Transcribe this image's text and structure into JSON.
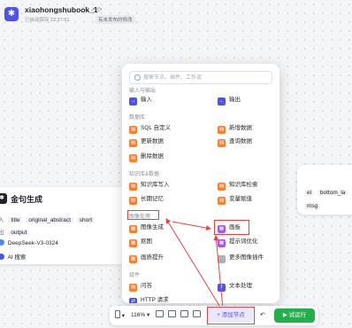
{
  "header": {
    "app_logo": "✱",
    "title": "xiaohongshubook_1",
    "title_icons": "ⓘ ↗ ⟳",
    "save_status": "已自动保存 22:37:51",
    "unpublished_badge": "有未发布的修改"
  },
  "left_node": {
    "icon": "✱",
    "title": "金句生成",
    "input_label": "入",
    "input_chips": [
      "title",
      "original_abstract",
      "short"
    ],
    "output_label": "出",
    "output_chip": "output",
    "model": "DeepSeek-V3-0324",
    "plugin": "AI 搜索"
  },
  "right_node": {
    "chip_a": "el",
    "chip_b": "bottom_la",
    "chip_c": "msg"
  },
  "menu": {
    "search_placeholder": "搜索节点、插件、工作流",
    "partial_section": "输入与输出",
    "io_items": [
      "输入",
      "输出"
    ],
    "db_section": "数据库",
    "db_items": [
      "SQL 自定义",
      "新增数据",
      "更新数据",
      "查询数据",
      "删除数据"
    ],
    "kb_section": "知识库&数据",
    "kb_items": [
      "知识库写入",
      "知识库检索",
      "长期记忆",
      "变量赋值"
    ],
    "img_section": "图像处理",
    "img_items": [
      "图像生成",
      "画板",
      "抠图",
      "提示词优化",
      "画质提升",
      "更多图像插件"
    ],
    "comp_section": "组件",
    "comp_items": [
      "问答",
      "文本处理",
      "HTTP 请求"
    ]
  },
  "toolbar": {
    "zoom": "116%",
    "add_node": "+ 添加节点",
    "run": "▶ 试运行"
  },
  "colors": {
    "accent": "#4d53e8",
    "db_orange": "#ff7d2e",
    "run_green": "#22b04b",
    "annotation_red": "#f03e3e"
  }
}
